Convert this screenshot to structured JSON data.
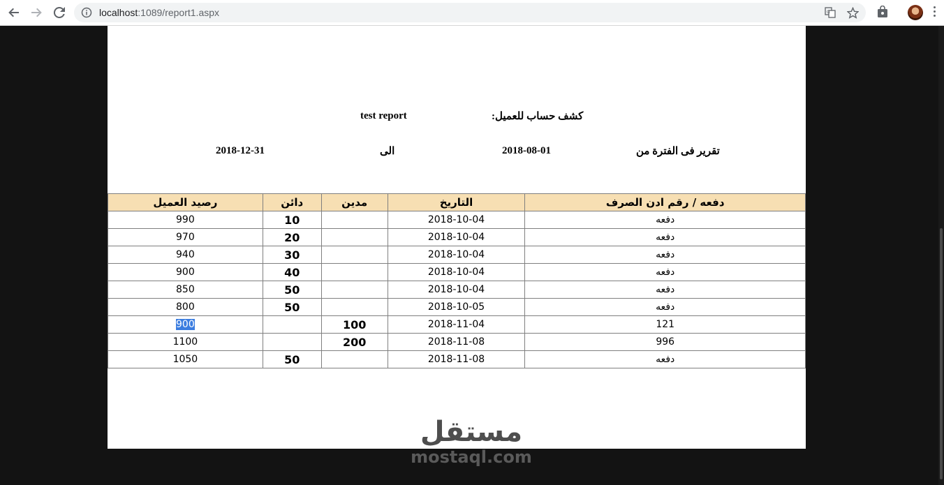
{
  "browser": {
    "url_host": "localhost",
    "url_rest": ":1089/report1.aspx"
  },
  "report": {
    "title_label": "كشف حساب للعميل:",
    "title_value": "test report",
    "period_label": "تقرير فى الفترة من",
    "date_from": "2018-08-01",
    "to_label": "الى",
    "date_to": "2018-12-31"
  },
  "table": {
    "headers": {
      "ref": "دفعه / رقم ادن الصرف",
      "date": "التاريخ",
      "debit": "مدين",
      "credit": "دائن",
      "balance": "رصيد العميل"
    },
    "rows": [
      {
        "ref": "دفعه",
        "date": "2018-10-04",
        "debit": "",
        "credit": "10",
        "balance": "990"
      },
      {
        "ref": "دفعه",
        "date": "2018-10-04",
        "debit": "",
        "credit": "20",
        "balance": "970"
      },
      {
        "ref": "دفعه",
        "date": "2018-10-04",
        "debit": "",
        "credit": "30",
        "balance": "940"
      },
      {
        "ref": "دفعه",
        "date": "2018-10-04",
        "debit": "",
        "credit": "40",
        "balance": "900"
      },
      {
        "ref": "دفعه",
        "date": "2018-10-04",
        "debit": "",
        "credit": "50",
        "balance": "850"
      },
      {
        "ref": "دفعه",
        "date": "2018-10-05",
        "debit": "",
        "credit": "50",
        "balance": "800"
      },
      {
        "ref": "121",
        "date": "2018-11-04",
        "debit": "100",
        "credit": "",
        "balance": "900"
      },
      {
        "ref": "996",
        "date": "2018-11-08",
        "debit": "200",
        "credit": "",
        "balance": "1100"
      },
      {
        "ref": "دفعه",
        "date": "2018-11-08",
        "debit": "",
        "credit": "50",
        "balance": "1050"
      }
    ]
  },
  "watermark": {
    "arabic": "مستقل",
    "latin": "mostaql.com"
  },
  "colors": {
    "header_bg": "#f7dfb3",
    "selection": "#3b7de0",
    "page_bg": "#131313"
  }
}
